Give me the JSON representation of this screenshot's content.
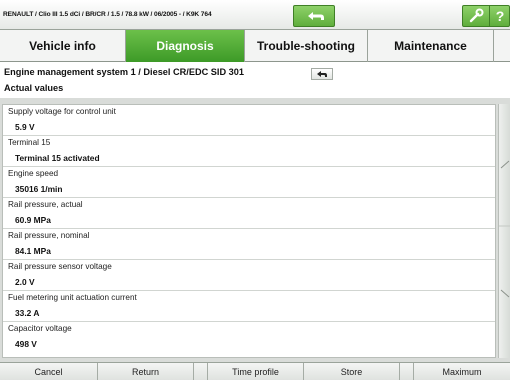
{
  "titlebar": {
    "title": "RENAULT / Clio III 1.5 dCi / BR/CR / 1.5 / 78.8 kW / 06/2005 - / K9K 764",
    "back_icon": "back-arrow-icon",
    "tools_icon": "wrench-icon",
    "help_label": "?"
  },
  "tabs": [
    {
      "label": "Vehicle info"
    },
    {
      "label": "Diagnosis"
    },
    {
      "label": "Trouble-shooting"
    },
    {
      "label": "Maintenance"
    }
  ],
  "active_tab": "Diagnosis",
  "header": {
    "system": "Engine management system 1 / Diesel CR/EDC SID 301",
    "section": "Actual values",
    "back_icon": "back-arrow-icon"
  },
  "values": [
    {
      "label": "Supply voltage for control unit",
      "value": "5.9 V"
    },
    {
      "label": "Terminal 15",
      "value": "Terminal 15 activated"
    },
    {
      "label": "Engine speed",
      "value": "35016 1/min"
    },
    {
      "label": "Rail pressure, actual",
      "value": "60.9 MPa"
    },
    {
      "label": "Rail pressure, nominal",
      "value": "84.1 MPa"
    },
    {
      "label": "Rail pressure sensor voltage",
      "value": "2.0 V"
    },
    {
      "label": "Fuel metering unit actuation current",
      "value": "33.2 A"
    },
    {
      "label": "Capacitor voltage",
      "value": "498 V"
    }
  ],
  "footer": {
    "cancel": "Cancel",
    "return": "Return",
    "time_profile": "Time profile",
    "store": "Store",
    "maximum": "Maximum"
  },
  "colors": {
    "accent_green": "#4caf34",
    "tab_active_text": "#ffffff"
  }
}
